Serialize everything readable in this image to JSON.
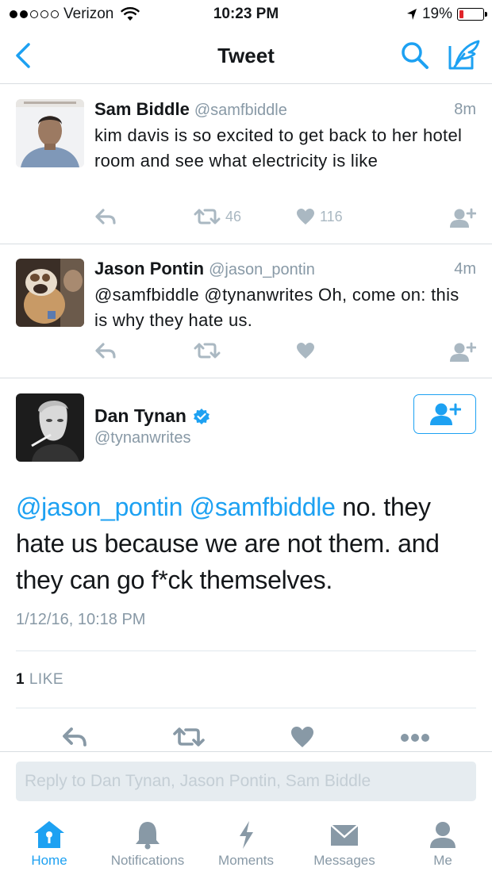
{
  "status_bar": {
    "carrier": "Verizon",
    "time": "10:23 PM",
    "battery": "19%",
    "battery_level": 0.19,
    "signal_bars_filled": 2,
    "signal_bars_total": 5
  },
  "nav": {
    "title": "Tweet"
  },
  "colors": {
    "accent": "#1da1f2",
    "muted": "#8899a6",
    "action_gray": "#aab8c2"
  },
  "tweets": [
    {
      "name": "Sam Biddle",
      "handle": "@samfbiddle",
      "time": "8m",
      "text": "kim davis is so excited to get back to her hotel room and see what electricity is like",
      "retweets": "46",
      "likes": "116"
    },
    {
      "name": "Jason Pontin",
      "handle": "@jason_pontin",
      "time": "4m",
      "text": "@samfbiddle @tynanwrites Oh, come on: this is why they hate us.",
      "retweets": "",
      "likes": ""
    }
  ],
  "main_tweet": {
    "name": "Dan Tynan",
    "handle": "@tynanwrites",
    "mention1": "@jason_pontin",
    "mention2": "@samfbiddle",
    "text": " no. they hate us because we are not them. and they can go f*ck themselves.",
    "date": "1/12/16, 10:18 PM",
    "like_count": "1",
    "like_label": "LIKE"
  },
  "reply": {
    "placeholder": "Reply to Dan Tynan, Jason Pontin, Sam Biddle"
  },
  "tabs": [
    {
      "label": "Home",
      "icon": "home-icon"
    },
    {
      "label": "Notifications",
      "icon": "bell-icon"
    },
    {
      "label": "Moments",
      "icon": "lightning-icon"
    },
    {
      "label": "Messages",
      "icon": "envelope-icon"
    },
    {
      "label": "Me",
      "icon": "person-icon"
    }
  ]
}
